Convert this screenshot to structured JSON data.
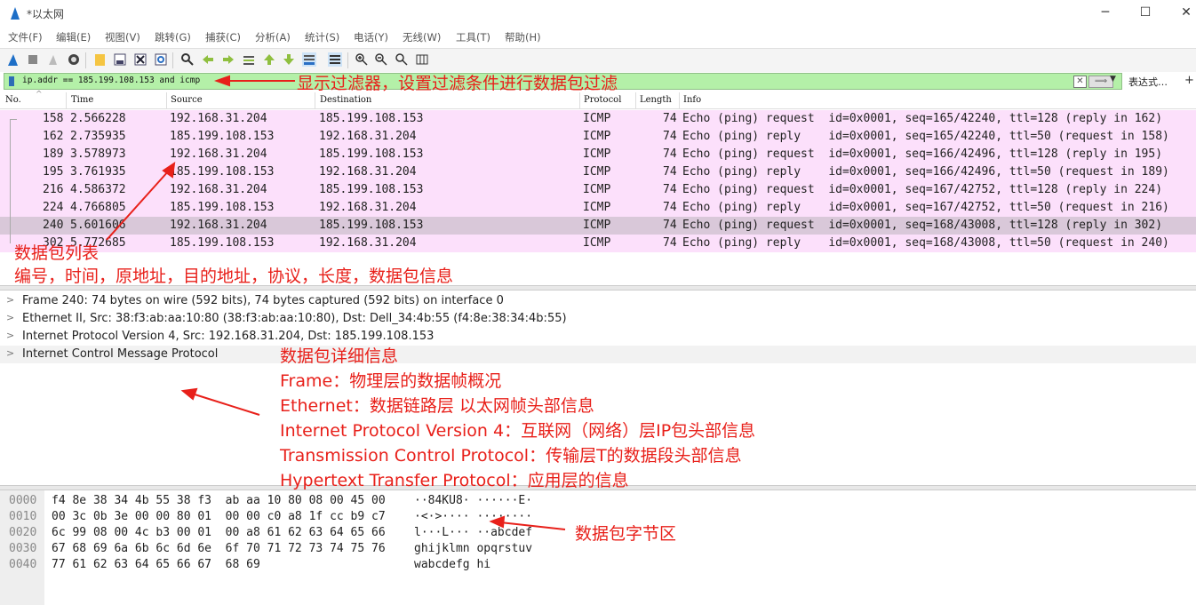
{
  "window": {
    "title": "*以太网",
    "minimize": "─",
    "maximize": "☐",
    "close": "✕"
  },
  "menu": [
    "文件(F)",
    "编辑(E)",
    "视图(V)",
    "跳转(G)",
    "捕获(C)",
    "分析(A)",
    "统计(S)",
    "电话(Y)",
    "无线(W)",
    "工具(T)",
    "帮助(H)"
  ],
  "toolbar_icons": [
    "shark-fin-start-icon",
    "stop-icon",
    "restart-icon",
    "options-icon",
    "open-file-icon",
    "save-file-icon",
    "close-file-icon",
    "reload-icon",
    "find-icon",
    "back-icon",
    "forward-icon",
    "goto-icon",
    "first-icon",
    "last-icon",
    "autoscroll-icon",
    "colorize-icon",
    "zoom-in-icon",
    "zoom-out-icon",
    "zoom-reset-icon",
    "resize-columns-icon"
  ],
  "filter": {
    "value": "ip.addr == 185.199.108.153 and icmp",
    "expression_button": "表达式…",
    "plus_button": "+"
  },
  "packet_list": {
    "columns": [
      "No.",
      "Time",
      "Source",
      "Destination",
      "Protocol",
      "Length",
      "Info"
    ],
    "rows": [
      {
        "no": "158",
        "time": "2.566228",
        "src": "192.168.31.204",
        "dst": "185.199.108.153",
        "proto": "ICMP",
        "len": "74",
        "info": "Echo (ping) request  id=0x0001, seq=165/42240, ttl=128 (reply in 162)"
      },
      {
        "no": "162",
        "time": "2.735935",
        "src": "185.199.108.153",
        "dst": "192.168.31.204",
        "proto": "ICMP",
        "len": "74",
        "info": "Echo (ping) reply    id=0x0001, seq=165/42240, ttl=50 (request in 158)"
      },
      {
        "no": "189",
        "time": "3.578973",
        "src": "192.168.31.204",
        "dst": "185.199.108.153",
        "proto": "ICMP",
        "len": "74",
        "info": "Echo (ping) request  id=0x0001, seq=166/42496, ttl=128 (reply in 195)"
      },
      {
        "no": "195",
        "time": "3.761935",
        "src": "185.199.108.153",
        "dst": "192.168.31.204",
        "proto": "ICMP",
        "len": "74",
        "info": "Echo (ping) reply    id=0x0001, seq=166/42496, ttl=50 (request in 189)"
      },
      {
        "no": "216",
        "time": "4.586372",
        "src": "192.168.31.204",
        "dst": "185.199.108.153",
        "proto": "ICMP",
        "len": "74",
        "info": "Echo (ping) request  id=0x0001, seq=167/42752, ttl=128 (reply in 224)"
      },
      {
        "no": "224",
        "time": "4.766805",
        "src": "185.199.108.153",
        "dst": "192.168.31.204",
        "proto": "ICMP",
        "len": "74",
        "info": "Echo (ping) reply    id=0x0001, seq=167/42752, ttl=50 (request in 216)"
      },
      {
        "no": "240",
        "time": "5.601606",
        "src": "192.168.31.204",
        "dst": "185.199.108.153",
        "proto": "ICMP",
        "len": "74",
        "info": "Echo (ping) request  id=0x0001, seq=168/43008, ttl=128 (reply in 302)"
      },
      {
        "no": "302",
        "time": "5.772685",
        "src": "185.199.108.153",
        "dst": "192.168.31.204",
        "proto": "ICMP",
        "len": "74",
        "info": "Echo (ping) reply    id=0x0001, seq=168/43008, ttl=50 (request in 240)"
      }
    ],
    "selected_row": 6,
    "row_color": "#fce0fb",
    "selected_color": "#d9c8d9"
  },
  "details": [
    "Frame 240: 74 bytes on wire (592 bits), 74 bytes captured (592 bits) on interface 0",
    "Ethernet II, Src: 38:f3:ab:aa:10:80 (38:f3:ab:aa:10:80), Dst: Dell_34:4b:55 (f4:8e:38:34:4b:55)",
    "Internet Protocol Version 4, Src: 192.168.31.204, Dst: 185.199.108.153",
    "Internet Control Message Protocol"
  ],
  "bytes": {
    "offsets": [
      "0000",
      "0010",
      "0020",
      "0030",
      "0040"
    ],
    "hex": [
      "f4 8e 38 34 4b 55 38 f3  ab aa 10 80 08 00 45 00",
      "00 3c 0b 3e 00 00 80 01  00 00 c0 a8 1f cc b9 c7",
      "6c 99 08 00 4c b3 00 01  00 a8 61 62 63 64 65 66",
      "67 68 69 6a 6b 6c 6d 6e  6f 70 71 72 73 74 75 76",
      "77 61 62 63 64 65 66 67  68 69"
    ],
    "ascii": [
      "··84KU8· ······E·",
      "·<·>···· ········",
      "l···L··· ··abcdef",
      "ghijklmn opqrstuv",
      "wabcdefg hi"
    ]
  },
  "annotations": {
    "filter_note": "显示过滤器，设置过滤条件进行数据包过滤",
    "list_title": "数据包列表",
    "list_desc": "编号，时间，原地址，目的地址，协议，长度，数据包信息",
    "detail_title": "数据包详细信息",
    "detail_frame": "Frame：物理层的数据帧概况",
    "detail_eth": "Ethernet：数据链路层 以太网帧头部信息",
    "detail_ip": "Internet Protocol Version 4：互联网（网络）层IP包头部信息",
    "detail_tcp": "Transmission Control Protocol：传输层T的数据段头部信息",
    "detail_http": "Hypertext Transfer Protocol：应用层的信息",
    "bytes_title": "数据包字节区",
    "color": "#e8201a"
  }
}
